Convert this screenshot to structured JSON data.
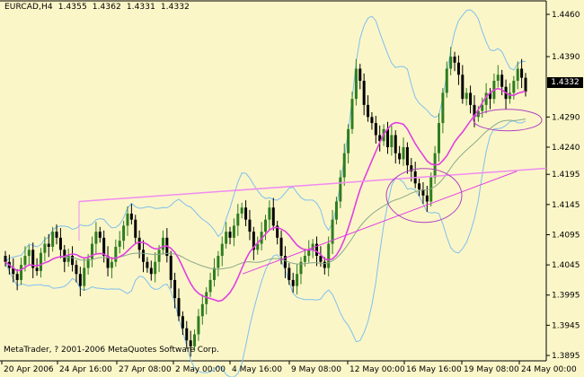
{
  "header": {
    "symbol": "EURCAD,H4",
    "open": "1.4355",
    "high": "1.4362",
    "low": "1.4331",
    "close": "1.4332"
  },
  "current_price_tag": "1.4332",
  "copyright": "MetaTrader, ? 2001-2006 MetaQuotes Software Corp.",
  "colors": {
    "background": "#fbf6c8",
    "bull_candle": "#2e7d1f",
    "bear_candle": "#000000",
    "bollinger": "#7ec0ee",
    "moving_average": "#e040e0",
    "long_ma": "#88aa88",
    "trendline": "#f08cf0"
  },
  "chart_data": {
    "type": "candlestick",
    "y_ticks": [
      "1.4460",
      "1.4390",
      "1.4290",
      "1.4240",
      "1.4195",
      "1.4145",
      "1.4095",
      "1.4045",
      "1.3995",
      "1.3945",
      "1.3895"
    ],
    "x_ticks": [
      "20 Apr 2006",
      "24 Apr 16:00",
      "27 Apr 08:00",
      "2 May 00:00",
      "4 May 16:00",
      "9 May 08:00",
      "12 May 00:00",
      "16 May 16:00",
      "19 May 08:00",
      "24 May 00:00"
    ],
    "ylim": [
      1.3895,
      1.446
    ],
    "series": [
      {
        "values": [
          1.405,
          1.404,
          1.403,
          1.402,
          1.4045,
          1.406,
          1.407,
          1.404,
          1.4035,
          1.4065,
          1.408,
          1.4075,
          1.41,
          1.409,
          1.407,
          1.405,
          1.406,
          1.4045,
          1.403,
          1.401,
          1.404,
          1.4055,
          1.408,
          1.41,
          1.409,
          1.406,
          1.404,
          1.405,
          1.4075,
          1.4085,
          1.411,
          1.413,
          1.412,
          1.409,
          1.407,
          1.405,
          1.404,
          1.403,
          1.405,
          1.407,
          1.409,
          1.406,
          1.402,
          1.399,
          1.396,
          1.394,
          1.392,
          1.391,
          1.393,
          1.396,
          1.398,
          1.4,
          1.402,
          1.404,
          1.406,
          1.408,
          1.41,
          1.409,
          1.411,
          1.413,
          1.414,
          1.412,
          1.41,
          1.407,
          1.408,
          1.41,
          1.412,
          1.414,
          1.411,
          1.409,
          1.406,
          1.404,
          1.402,
          1.401,
          1.403,
          1.405,
          1.406,
          1.407,
          1.408,
          1.406,
          1.405,
          1.404,
          1.408,
          1.412,
          1.415,
          1.419,
          1.423,
          1.427,
          1.432,
          1.437,
          1.435,
          1.431,
          1.429,
          1.428,
          1.426,
          1.425,
          1.427,
          1.424,
          1.426,
          1.423,
          1.422,
          1.424,
          1.421,
          1.42,
          1.418,
          1.417,
          1.416,
          1.415,
          1.419,
          1.423,
          1.428,
          1.433,
          1.437,
          1.439,
          1.438,
          1.436,
          1.432,
          1.433,
          1.431,
          1.429,
          1.43,
          1.431,
          1.433,
          1.432,
          1.435,
          1.436,
          1.434,
          1.432,
          1.433,
          1.435,
          1.437,
          1.4355,
          1.4332
        ]
      }
    ],
    "indicators": [
      "Bollinger Bands",
      "Moving Average",
      "Moving Average (long)",
      "Trendline",
      "Ellipse annotations"
    ]
  }
}
